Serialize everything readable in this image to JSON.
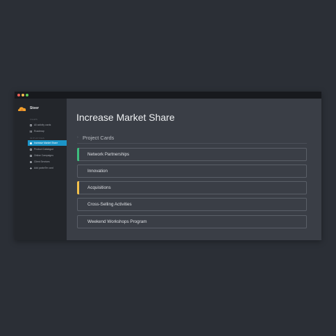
{
  "window": {
    "controls": [
      "close",
      "minimize",
      "maximize"
    ]
  },
  "sidebar": {
    "brand": {
      "name": "Steer",
      "icon": "cloud-logo-icon",
      "color": "#f4a12c"
    },
    "sections": [
      {
        "label": "VIEWS",
        "items": [
          {
            "label": "All activity cards",
            "icon": "grid-icon"
          },
          {
            "label": "Roadmap",
            "icon": "columns-icon"
          }
        ]
      },
      {
        "label": "INITIATIVES",
        "items": [
          {
            "label": "Increase Market Share",
            "icon": "initiative-icon",
            "active": true
          },
          {
            "label": "Product Catalogue",
            "icon": "catalogue-icon"
          },
          {
            "label": "Online Campaigns",
            "icon": "campaign-icon"
          },
          {
            "label": "Client Services",
            "icon": "services-icon"
          },
          {
            "label": "Add parkeTer card",
            "icon": "plus-icon"
          }
        ]
      }
    ],
    "accent_color": "#1c95c8"
  },
  "main": {
    "title": "Increase Market Share",
    "section_label": "Project Cards",
    "cards": [
      {
        "label": "Network Partnerships",
        "accent": "#3dbd7d"
      },
      {
        "label": "Innovation",
        "accent": null
      },
      {
        "label": "Acquisitions",
        "accent": "#f4c14b"
      },
      {
        "label": "Cross-Selling Activities",
        "accent": null
      },
      {
        "label": "Weekend Workshops Program",
        "accent": null
      }
    ]
  }
}
